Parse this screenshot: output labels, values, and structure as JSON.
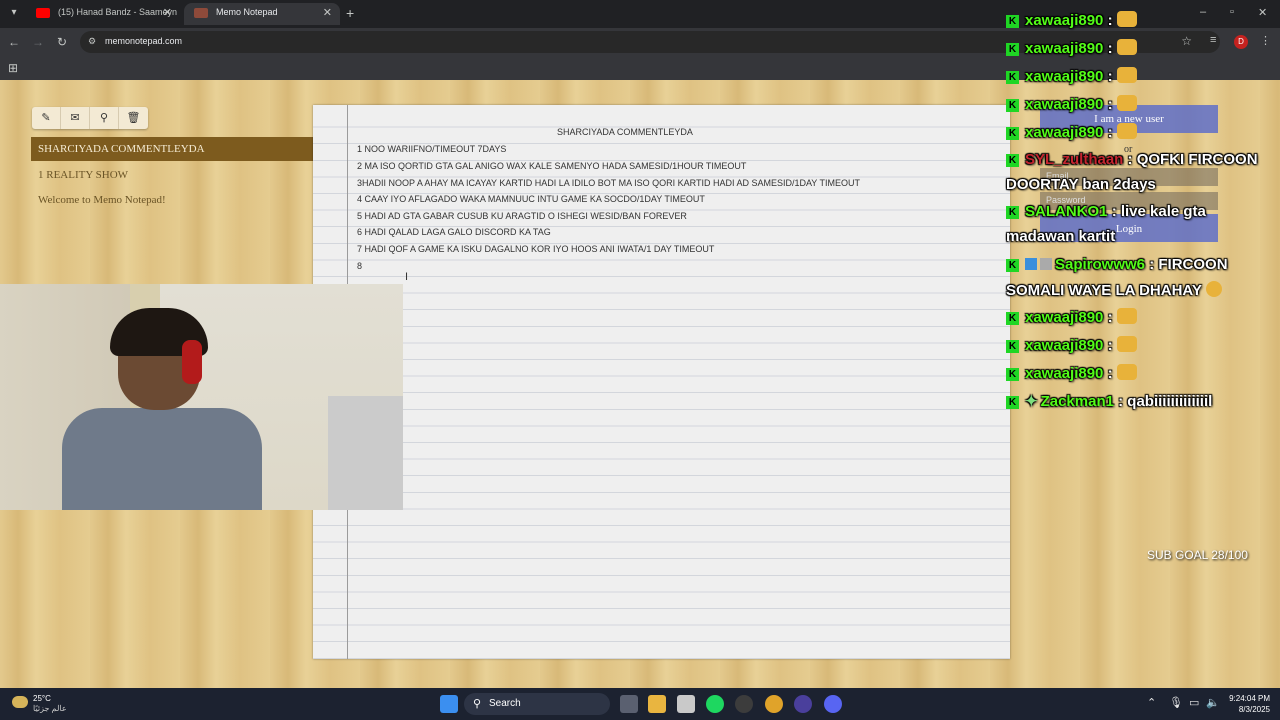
{
  "browser": {
    "tabs": [
      {
        "label": "(15) Hanad Bandz - Saameyn (l"
      },
      {
        "label": "Memo Notepad"
      }
    ],
    "url": "memonotepad.com",
    "profile_badge": "D"
  },
  "memo": {
    "sidebar_title": "SHARCIYADA COMMENTLEYDA",
    "links": [
      "1 REALITY SHOW",
      "Welcome to Memo Notepad!"
    ],
    "tools": [
      "pencil-icon",
      "envelope-icon",
      "search-icon",
      "trash-icon"
    ]
  },
  "note": {
    "heading": "SHARCIYADA COMMENTLEYDA",
    "lines": [
      "1 NOO WARIIFNO/TIMEOUT 7DAYS",
      "2 MA ISO QORTID GTA GAL ANIGO WAX KALE SAMENYO HADA SAMESID/1HOUR TIMEOUT",
      "3HADII NOOP A AHAY MA ICAYAY KARTID HADI LA IDILO BOT MA ISO QORI KARTID HADI AD SAMESID/1DAY TIMEOUT",
      "4  CAAY IYO AFLAGADO WAKA MAMNUUC INTU GAME KA SOCDO/1DAY TIMEOUT",
      "5 HADI AD GTA GABAR CUSUB KU ARAGTID O ISHEGI WESID/BAN FOREVER",
      "6 HADI QALAD LAGA GALO DISCORD KA TAG",
      "7 HADI QOF A GAME KA ISKU DAGALNO KOR IYO HOOS ANI IWATA/1 DAY TIMEOUT",
      "8"
    ]
  },
  "login_panel": {
    "new_user": "I am a new user",
    "or": "or",
    "email": "Email",
    "password": "Password",
    "login": "Login"
  },
  "chat": [
    {
      "user": "xawaaji890",
      "text": ":"
    },
    {
      "user": "xawaaji890",
      "text": ":"
    },
    {
      "user": "xawaaji890",
      "text": ":"
    },
    {
      "user": "xawaaji890",
      "text": ":"
    },
    {
      "user": "xawaaji890",
      "text": ":"
    },
    {
      "user": "SYL_zulthaan",
      "text": ": QOFKI FIRCOON",
      "text2": "DOORTAY ban 2days"
    },
    {
      "user": "SALANKO1",
      "text": ": live kale gta",
      "text2": "madawan kartit"
    },
    {
      "user": "Sapirowww6",
      "text": ": FIRCOON",
      "text2": "SOMALI WAYE LA DHAHAY"
    },
    {
      "user": "xawaaji890",
      "text": ":"
    },
    {
      "user": "xawaaji890",
      "text": ":"
    },
    {
      "user": "xawaaji890",
      "text": ":"
    },
    {
      "user": "Zackman1",
      "text": ": qabiiiiiiiiiiiiil"
    }
  ],
  "sub_goal": "SUB GOAL 28/100",
  "taskbar": {
    "temperature": "25°C",
    "condition": "عالم جزئيًا",
    "search": "Search",
    "time": "9:24:04 PM",
    "date": "8/3/2025"
  }
}
